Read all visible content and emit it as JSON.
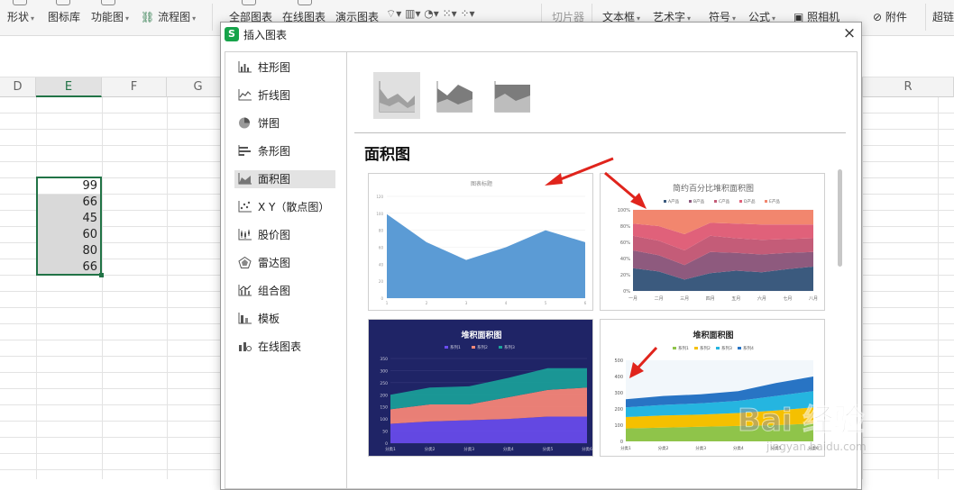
{
  "ribbon": {
    "items": [
      {
        "label": "形状",
        "dropdown": true
      },
      {
        "label": "图标库",
        "dropdown": false
      },
      {
        "label": "功能图",
        "dropdown": true
      },
      {
        "label": "流程图",
        "dropdown": true
      },
      {
        "label": "全部图表",
        "dropdown": false
      },
      {
        "label": "在线图表",
        "dropdown": false
      },
      {
        "label": "演示图表",
        "dropdown": false
      },
      {
        "label": "切片器",
        "dropdown": false
      },
      {
        "label": "文本框",
        "dropdown": true
      },
      {
        "label": "艺术字",
        "dropdown": true
      },
      {
        "label": "符号",
        "dropdown": true
      },
      {
        "label": "公式",
        "dropdown": true
      },
      {
        "label": "照相机",
        "dropdown": false
      },
      {
        "label": "附件",
        "dropdown": false
      },
      {
        "label": "超链",
        "dropdown": false
      }
    ]
  },
  "sheet": {
    "columns": [
      "D",
      "E",
      "F",
      "G",
      "R"
    ],
    "selected_column": "E",
    "values": [
      "99",
      "66",
      "45",
      "60",
      "80",
      "66"
    ]
  },
  "dialog": {
    "title": "插入图表",
    "logo": "S",
    "close": "×",
    "categories": [
      {
        "label": "柱形图",
        "icon": "column-chart-icon"
      },
      {
        "label": "折线图",
        "icon": "line-chart-icon"
      },
      {
        "label": "饼图",
        "icon": "pie-chart-icon"
      },
      {
        "label": "条形图",
        "icon": "bar-chart-icon"
      },
      {
        "label": "面积图",
        "icon": "area-chart-icon",
        "active": true
      },
      {
        "label": "X Y（散点图）",
        "icon": "scatter-chart-icon"
      },
      {
        "label": "股价图",
        "icon": "stock-chart-icon"
      },
      {
        "label": "雷达图",
        "icon": "radar-chart-icon"
      },
      {
        "label": "组合图",
        "icon": "combo-chart-icon"
      },
      {
        "label": "模板",
        "icon": "template-icon"
      },
      {
        "label": "在线图表",
        "icon": "online-chart-icon"
      }
    ],
    "section_title": "面积图",
    "thumbnails": [
      {
        "title": "图表标题",
        "chart_data": {
          "type": "area",
          "title": "图表标题",
          "x": [
            1,
            2,
            3,
            4,
            5,
            6
          ],
          "values": [
            99,
            66,
            45,
            60,
            80,
            66
          ],
          "ylim": [
            0,
            120
          ],
          "yticks": [
            0,
            20,
            40,
            60,
            80,
            100,
            120
          ],
          "color": "#5b9bd5"
        }
      },
      {
        "title": "简约百分比堆积面积图",
        "chart_data": {
          "type": "area",
          "stacked": "percent",
          "title": "简约百分比堆积面积图",
          "legend": [
            "A产品",
            "B产品",
            "C产品",
            "D产品",
            "E产品"
          ],
          "categories": [
            "一月",
            "二月",
            "三月",
            "四月",
            "五月",
            "六月",
            "七月",
            "八月"
          ],
          "yticks": [
            "0%",
            "20%",
            "40%",
            "60%",
            "80%",
            "100%"
          ],
          "series": [
            {
              "values": [
                28,
                24,
                14,
                22,
                25,
                23,
                27,
                30
              ]
            },
            {
              "values": [
                22,
                20,
                18,
                26,
                22,
                22,
                20,
                18
              ]
            },
            {
              "values": [
                18,
                18,
                18,
                20,
                18,
                18,
                17,
                17
              ]
            },
            {
              "values": [
                15,
                18,
                20,
                16,
                18,
                19,
                18,
                17
              ]
            },
            {
              "values": [
                17,
                20,
                30,
                16,
                17,
                18,
                18,
                18
              ]
            }
          ],
          "colors": [
            "#3b5a7e",
            "#8e5a7e",
            "#c45c78",
            "#e0617a",
            "#f2866e"
          ]
        }
      },
      {
        "title": "堆积面积图",
        "chart_data": {
          "type": "area",
          "stacked": true,
          "title": "堆积面积图",
          "legend": [
            "系列1",
            "系列2",
            "系列3"
          ],
          "categories": [
            "分类1",
            "分类2",
            "分类3",
            "分类4",
            "分类5",
            "分类6"
          ],
          "ylim": [
            0,
            350
          ],
          "yticks": [
            0,
            50,
            100,
            150,
            200,
            250,
            300,
            350
          ],
          "series": [
            {
              "name": "系列1",
              "values": [
                80,
                90,
                95,
                100,
                110,
                110
              ]
            },
            {
              "name": "系列2",
              "values": [
                60,
                70,
                65,
                90,
                110,
                120
              ]
            },
            {
              "name": "系列3",
              "values": [
                60,
                70,
                75,
                80,
                90,
                80
              ]
            }
          ],
          "colors": [
            "#6a4cf0",
            "#ff8a78",
            "#1aa39a"
          ],
          "background": "#1f2466"
        }
      },
      {
        "title": "堆积面积图",
        "chart_data": {
          "type": "area",
          "stacked": true,
          "title": "堆积面积图",
          "legend": [
            "系列1",
            "系列2",
            "系列3",
            "系列4"
          ],
          "categories": [
            "分类1",
            "分类2",
            "分类3",
            "分类4",
            "分类5",
            "分类6"
          ],
          "ylim": [
            0,
            500
          ],
          "yticks": [
            0,
            100,
            200,
            300,
            400,
            500
          ],
          "series": [
            {
              "name": "系列1",
              "values": [
                80,
                85,
                90,
                95,
                100,
                110
              ]
            },
            {
              "name": "系列2",
              "values": [
                70,
                75,
                75,
                80,
                90,
                100
              ]
            },
            {
              "name": "系列3",
              "values": [
                60,
                65,
                70,
                75,
                90,
                100
              ]
            },
            {
              "name": "系列4",
              "values": [
                50,
                55,
                55,
                60,
                80,
                90
              ]
            }
          ],
          "colors": [
            "#8fc44a",
            "#f5c000",
            "#25b5e0",
            "#2874c4"
          ]
        }
      }
    ]
  },
  "watermark": {
    "text": "Bai  经验",
    "sub": "jingyan.baidu.com"
  }
}
